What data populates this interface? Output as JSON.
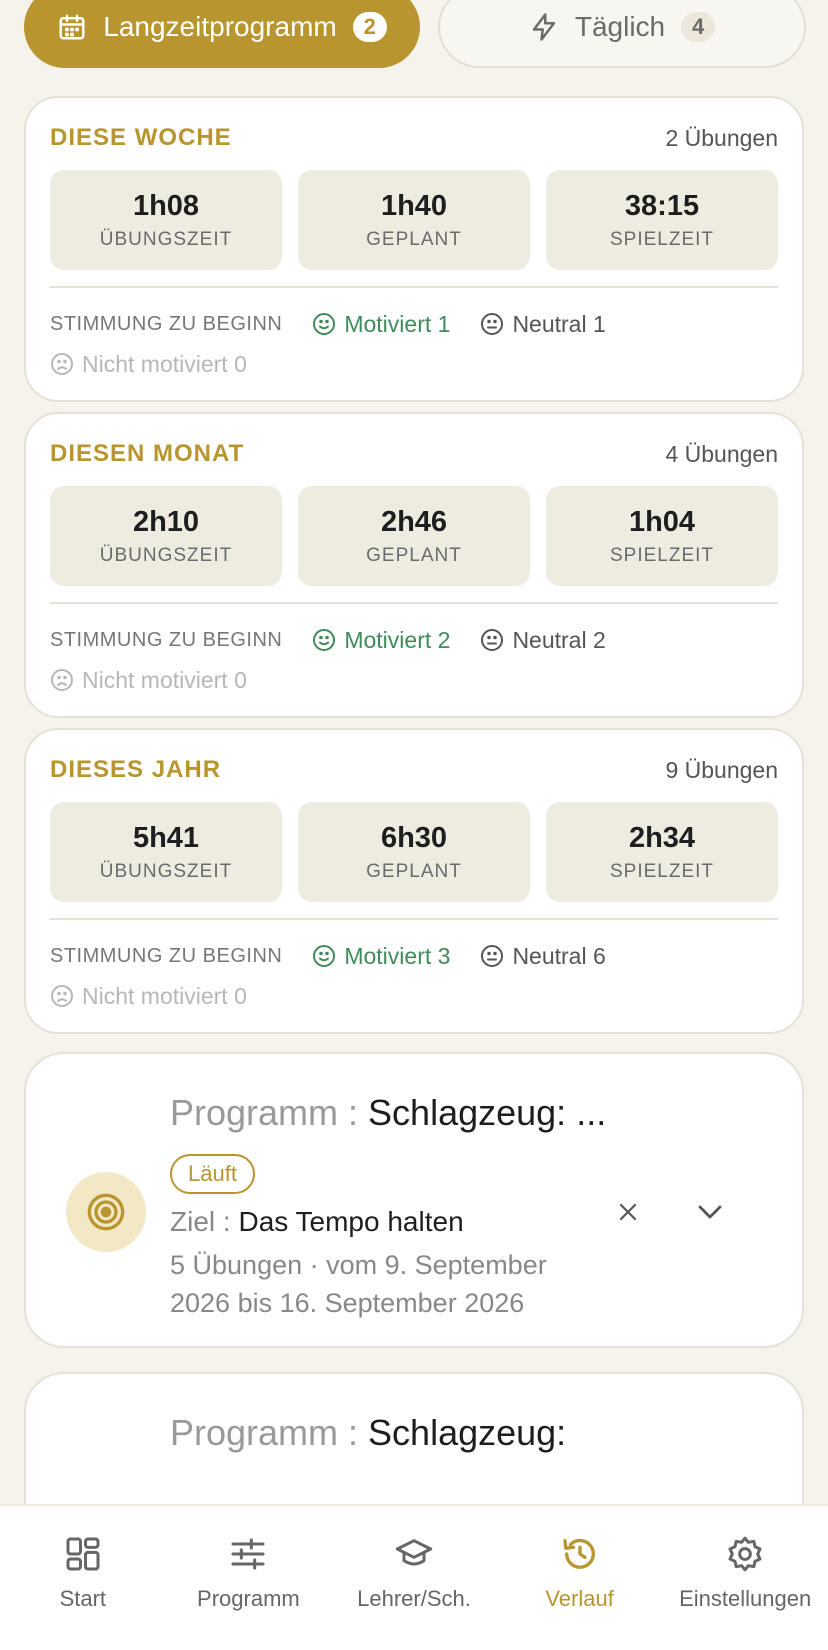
{
  "tabs": [
    {
      "label": "Langzeitprogramm",
      "count": "2",
      "icon": "calendar-icon"
    },
    {
      "label": "Täglich",
      "count": "4",
      "icon": "lightning-icon"
    }
  ],
  "stats": [
    {
      "title": "DIESE WOCHE",
      "count": "2 Übungen",
      "tiles": [
        {
          "value": "1h08",
          "label": "ÜBUNGSZEIT"
        },
        {
          "value": "1h40",
          "label": "GEPLANT"
        },
        {
          "value": "38:15",
          "label": "SPIELZEIT"
        }
      ],
      "mood_label": "STIMMUNG ZU BEGINN",
      "motivated": "Motiviert 1",
      "neutral": "Neutral 1",
      "not_motivated": "Nicht motiviert 0"
    },
    {
      "title": "DIESEN MONAT",
      "count": "4 Übungen",
      "tiles": [
        {
          "value": "2h10",
          "label": "ÜBUNGSZEIT"
        },
        {
          "value": "2h46",
          "label": "GEPLANT"
        },
        {
          "value": "1h04",
          "label": "SPIELZEIT"
        }
      ],
      "mood_label": "STIMMUNG ZU BEGINN",
      "motivated": "Motiviert 2",
      "neutral": "Neutral 2",
      "not_motivated": "Nicht motiviert 0"
    },
    {
      "title": "DIESES JAHR",
      "count": "9 Übungen",
      "tiles": [
        {
          "value": "5h41",
          "label": "ÜBUNGSZEIT"
        },
        {
          "value": "6h30",
          "label": "GEPLANT"
        },
        {
          "value": "2h34",
          "label": "SPIELZEIT"
        }
      ],
      "mood_label": "STIMMUNG ZU BEGINN",
      "motivated": "Motiviert 3",
      "neutral": "Neutral 6",
      "not_motivated": "Nicht motiviert 0"
    }
  ],
  "programs": [
    {
      "prefix": "Programm : ",
      "name": "Schlagzeug: ...",
      "status": "Läuft",
      "goal_label": "Ziel : ",
      "goal_value": "Das Tempo halten",
      "meta": "5 Übungen · vom 9. September 2026 bis 16. September 2026"
    },
    {
      "prefix": "Programm : ",
      "name": "Schlagzeug:"
    }
  ],
  "nav": [
    {
      "label": "Start",
      "icon": "grid-icon"
    },
    {
      "label": "Programm",
      "icon": "sliders-icon"
    },
    {
      "label": "Lehrer/Sch.",
      "icon": "graduation-cap-icon"
    },
    {
      "label": "Verlauf",
      "icon": "history-icon",
      "active": true
    },
    {
      "label": "Einstellungen",
      "icon": "gear-icon"
    }
  ],
  "colors": {
    "accent": "#b8952e",
    "motivated": "#3f8b5a",
    "background": "#f6f3ec"
  }
}
